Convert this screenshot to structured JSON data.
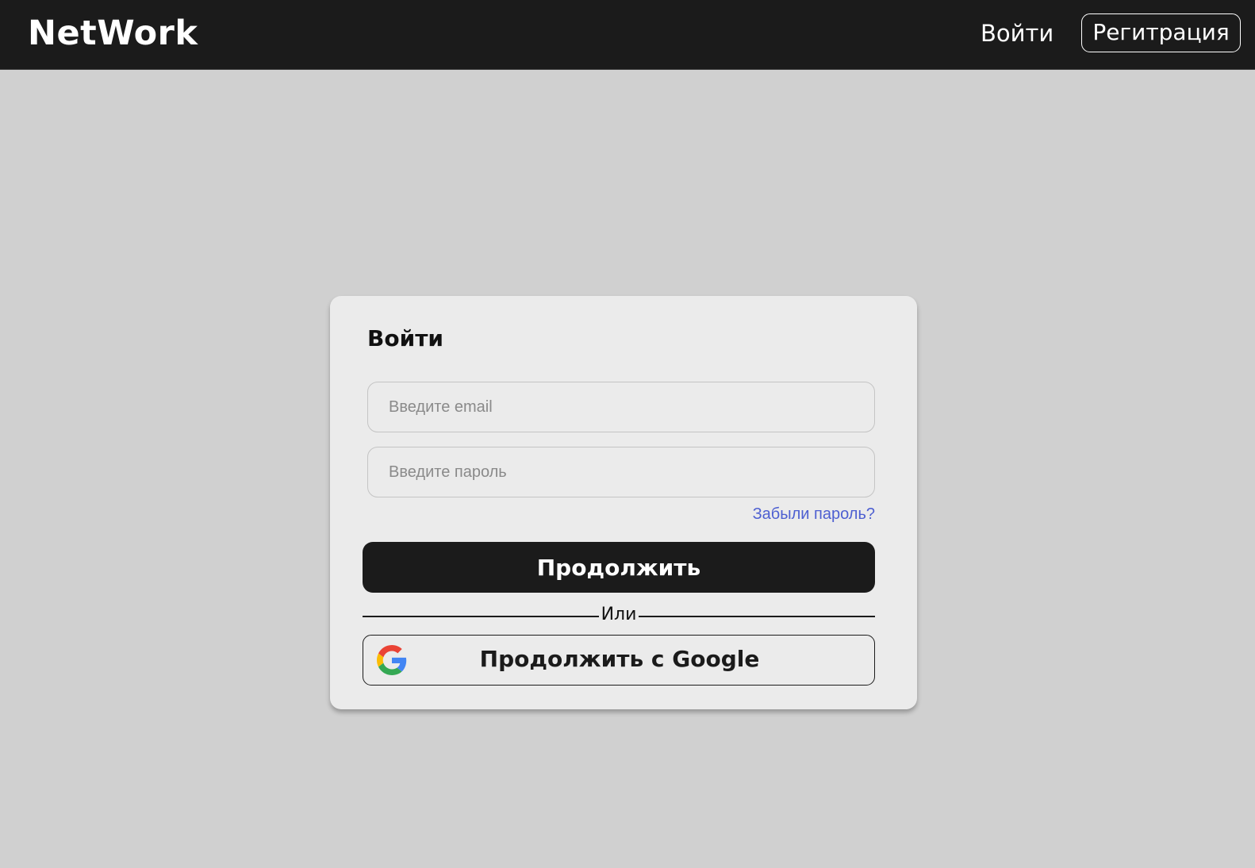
{
  "header": {
    "logo": "NetWork",
    "login_link": "Войти",
    "register_button": "Регитрация",
    "background_color": "#1b1b1b"
  },
  "login_card": {
    "title": "Войти",
    "email_placeholder": "Введите email",
    "password_placeholder": "Введите пароль",
    "forgot_link": "Забыли пароль?",
    "continue_button": "Продолжить",
    "divider_text": "Или",
    "google_button": "Продолжить с Google",
    "google_icon": "google-logo"
  },
  "colors": {
    "page_background": "#d0d0d0",
    "card_background": "#ebebeb",
    "link_color": "#4d5fd1",
    "primary_button": "#1b1b1b"
  }
}
